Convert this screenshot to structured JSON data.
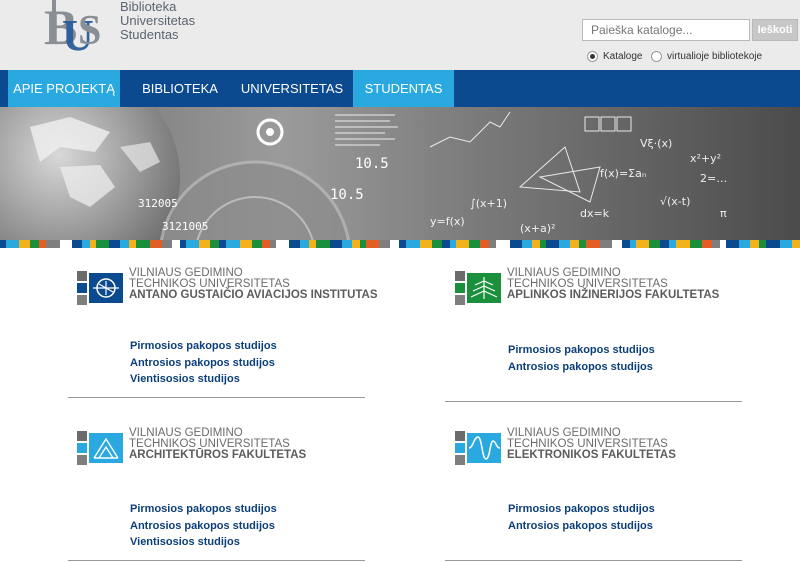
{
  "header": {
    "logo_lines": [
      "Biblioteka",
      "Universitetas",
      "Studentas"
    ],
    "search_placeholder": "Paieška kataloge...",
    "search_button_label": "Ieškoti",
    "radio_options": [
      {
        "label": "Kataloge",
        "checked": true
      },
      {
        "label": "virtualioje bibliotekoje",
        "checked": false
      }
    ]
  },
  "nav": {
    "items": [
      {
        "label": "APIE PROJEKTĄ",
        "active": true
      },
      {
        "label": "BIBLIOTEKA",
        "active": false
      },
      {
        "label": "UNIVERSITETAS",
        "active": false
      },
      {
        "label": "STUDENTAS",
        "active": true
      }
    ]
  },
  "banner": {
    "numbers": [
      "10.5",
      "10.5",
      "312005",
      "3121005"
    ]
  },
  "faculties": [
    {
      "line1": "VILNIAUS GEDIMINO",
      "line2": "TECHNIKOS UNIVERSITETAS",
      "title": "ANTANO GUSTAIČIO AVIACIJOS INSTITUTAS",
      "icon": "aviation-icon",
      "links": [
        "Pirmosios pakopos studijos",
        "Antrosios pakopos studijos",
        "Vientisosios studijos"
      ]
    },
    {
      "line1": "VILNIAUS GEDIMINO",
      "line2": "TECHNIKOS UNIVERSITETAS",
      "title": "APLINKOS INŽINERIJOS FAKULTETAS",
      "icon": "tree-icon",
      "links": [
        "Pirmosios pakopos studijos",
        "Antrosios pakopos studijos"
      ]
    },
    {
      "line1": "VILNIAUS GEDIMINO",
      "line2": "TECHNIKOS UNIVERSITETAS",
      "title": "ARCHITEKTŪROS FAKULTETAS",
      "icon": "architecture-icon",
      "links": [
        "Pirmosios pakopos studijos",
        "Antrosios pakopos studijos",
        "Vientisosios studijos"
      ]
    },
    {
      "line1": "VILNIAUS GEDIMINO",
      "line2": "TECHNIKOS UNIVERSITETAS",
      "title": "ELEKTRONIKOS FAKULTETAS",
      "icon": "wave-icon",
      "links": [
        "Pirmosios pakopos studijos",
        "Antrosios pakopos studijos"
      ]
    }
  ],
  "colors": {
    "nav_bg": "#0c4a8f",
    "nav_active": "#2aa9e0",
    "aviation": "#0c4a8f",
    "environment": "#1a8f3c",
    "architecture": "#2aa9e0",
    "electronics": "#2aa9e0",
    "link": "#0c3f7a"
  }
}
